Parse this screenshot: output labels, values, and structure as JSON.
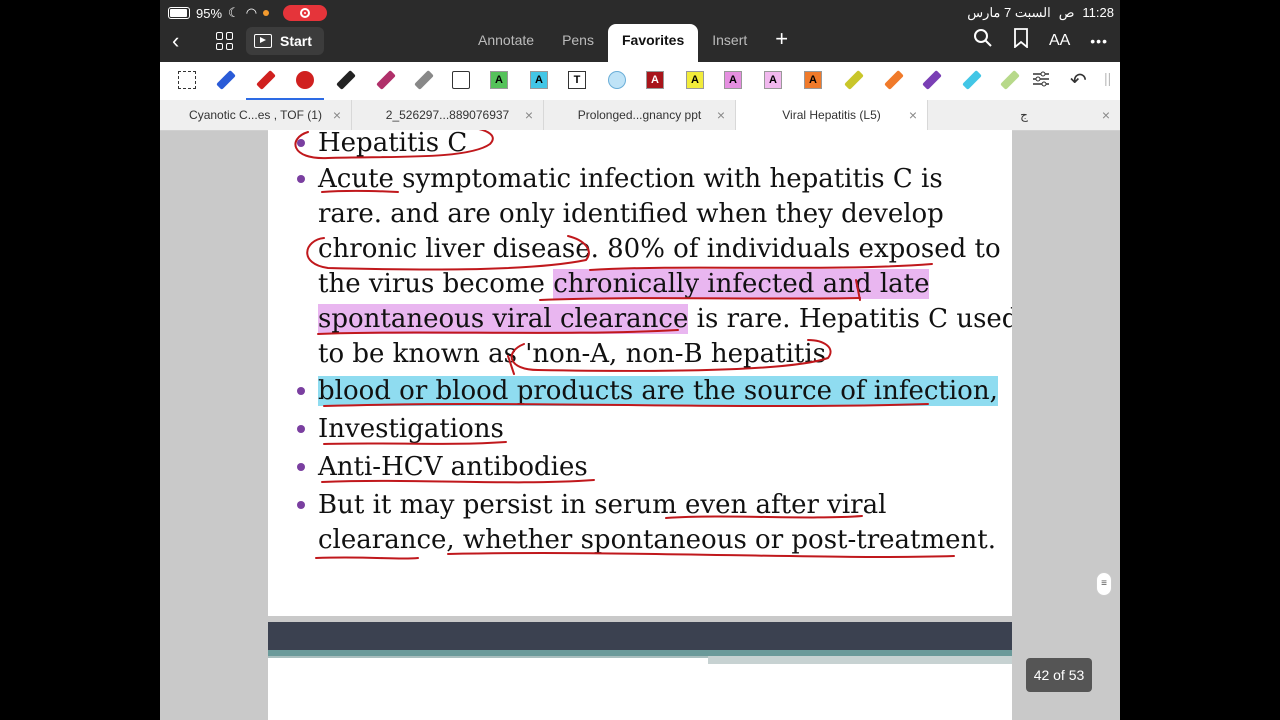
{
  "status": {
    "battery": "95%",
    "time": "11:28",
    "am_pm": "ص",
    "date": "السبت 7 مارس"
  },
  "nav": {
    "back_glyph": "‹",
    "start_label": "Start",
    "tabs": [
      {
        "label": "Annotate"
      },
      {
        "label": "Pens"
      },
      {
        "label": "Favorites"
      },
      {
        "label": "Insert"
      }
    ],
    "plus": "+",
    "text_size": "AA",
    "more": "•••"
  },
  "toolbar": {
    "colors": {
      "blue": "#2a5bd7",
      "red": "#d0201f",
      "darkred": "#a8141a",
      "yellow": "#f2ec3a",
      "pink": "#e58fe0",
      "green": "#55c25a",
      "cyan": "#42c6e6",
      "orange": "#f07a2a",
      "purple": "#7a3fb5"
    },
    "hl_label": "A",
    "text_label": "T"
  },
  "filetabs": [
    {
      "label": "Cyanotic C...es , TOF (1)"
    },
    {
      "label": "2_526297...889076937"
    },
    {
      "label": "Prolonged...gnancy ppt"
    },
    {
      "label": "Viral Hepatitis (L5)"
    },
    {
      "label": "ج"
    }
  ],
  "slide": {
    "heading": "Hepatitis C",
    "p1_l1": "Acute symptomatic infection with hepatitis C is",
    "p1_l2": "rare. and are only identified when they develop",
    "p1_l3": "chronic liver disease. 80% of individuals exposed to",
    "p1_l4a": "the virus become ",
    "p1_l4b": "chronically infected and late",
    "p1_l5a": "spontaneous viral clearance",
    "p1_l5b": " is rare. Hepatitis C used",
    "p1_l6": "to be known as 'non-A, non-B hepatitis",
    "b2": " blood or blood products are the source of infection,",
    "b3": " Investigations",
    "b4": " Anti-HCV antibodies",
    "b5_l1": "But it may persist in serum even after viral",
    "b5_l2": "clearance, whether spontaneous or post-treatment."
  },
  "page_indicator": "42 of 53"
}
